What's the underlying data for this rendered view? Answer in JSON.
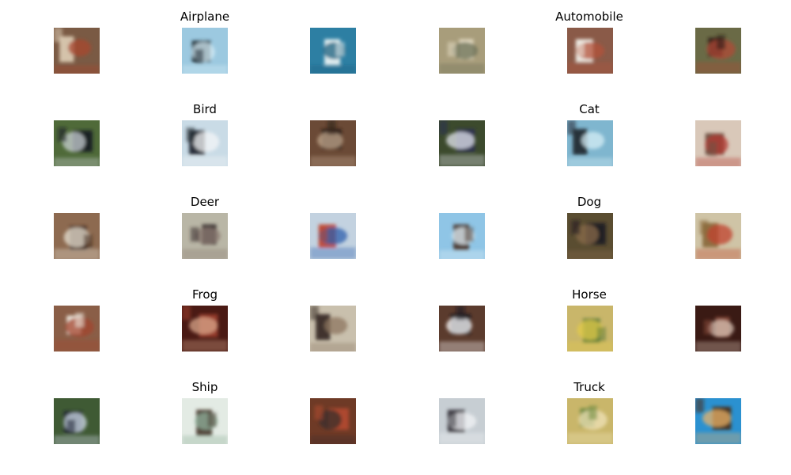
{
  "figure": {
    "groups": [
      {
        "label": "Airplane",
        "samples": [
          {
            "bg": "#7a5a44",
            "mid": "#d9c8b0",
            "accent": "#a8462f"
          },
          {
            "bg": "#9cc9e0",
            "mid": "#1f2b33",
            "accent": "#d7eef7"
          },
          {
            "bg": "#2d7fa3",
            "mid": "#e9f2f3",
            "accent": "#1b5f7d"
          }
        ]
      },
      {
        "label": "Automobile",
        "samples": [
          {
            "bg": "#a89d7b",
            "mid": "#e6dcc4",
            "accent": "#6a6f55"
          },
          {
            "bg": "#8a5a48",
            "mid": "#f0efe8",
            "accent": "#b3523a"
          },
          {
            "bg": "#6a6a46",
            "mid": "#2a1c18",
            "accent": "#b04a36"
          }
        ]
      },
      {
        "label": "Bird",
        "samples": [
          {
            "bg": "#4f6a39",
            "mid": "#161a24",
            "accent": "#c8d0d3"
          },
          {
            "bg": "#c9dbe6",
            "mid": "#222931",
            "accent": "#f4f6f7"
          },
          {
            "bg": "#6b4a36",
            "mid": "#2b1c16",
            "accent": "#c2a88e"
          }
        ]
      },
      {
        "label": "Cat",
        "samples": [
          {
            "bg": "#3c4a2d",
            "mid": "#2a2e52",
            "accent": "#e3e6ef"
          },
          {
            "bg": "#7fb6cf",
            "mid": "#242a33",
            "accent": "#d6eef6"
          },
          {
            "bg": "#d9c8b9",
            "mid": "#6e5042",
            "accent": "#b43a33"
          }
        ]
      },
      {
        "label": "Deer",
        "samples": [
          {
            "bg": "#8d6a50",
            "mid": "#3e2417",
            "accent": "#e7e1d4"
          },
          {
            "bg": "#b9b6a6",
            "mid": "#332a2a",
            "accent": "#8d7c74"
          },
          {
            "bg": "#c3d2e0",
            "mid": "#c04630",
            "accent": "#2f5fae"
          }
        ]
      },
      {
        "label": "Dog",
        "samples": [
          {
            "bg": "#8fc5e6",
            "mid": "#4e3a2f",
            "accent": "#e1f0f7"
          },
          {
            "bg": "#5a4d31",
            "mid": "#1e1a22",
            "accent": "#8a6b49"
          },
          {
            "bg": "#cfc4a6",
            "mid": "#8a6a3c",
            "accent": "#c0412f"
          }
        ]
      },
      {
        "label": "Frog",
        "samples": [
          {
            "bg": "#8a5e47",
            "mid": "#f1ede4",
            "accent": "#a2442f"
          },
          {
            "bg": "#4a1a14",
            "mid": "#9a3b2a",
            "accent": "#d8a68a"
          },
          {
            "bg": "#c9c0ad",
            "mid": "#3a2d28",
            "accent": "#8d7560"
          }
        ]
      },
      {
        "label": "Horse",
        "samples": [
          {
            "bg": "#5b3b2d",
            "mid": "#13141d",
            "accent": "#ffffff"
          },
          {
            "bg": "#c9b66a",
            "mid": "#5c7c3b",
            "accent": "#e3cb48"
          },
          {
            "bg": "#3a1a14",
            "mid": "#8a4b3a",
            "accent": "#d7c2b4"
          }
        ]
      },
      {
        "label": "Ship",
        "samples": [
          {
            "bg": "#3f5a34",
            "mid": "#1b2332",
            "accent": "#d0dbea"
          },
          {
            "bg": "#e3ebe4",
            "mid": "#4d3e33",
            "accent": "#8fb29b"
          },
          {
            "bg": "#6e3a26",
            "mid": "#b14a2e",
            "accent": "#3a2f2b"
          }
        ]
      },
      {
        "label": "Truck",
        "samples": [
          {
            "bg": "#c7ced3",
            "mid": "#3b3a42",
            "accent": "#f2f3f5"
          },
          {
            "bg": "#c9b66a",
            "mid": "#6f8a3e",
            "accent": "#efe1b8"
          },
          {
            "bg": "#2b91d0",
            "mid": "#4a2a14",
            "accent": "#e8b26a"
          }
        ]
      }
    ]
  }
}
